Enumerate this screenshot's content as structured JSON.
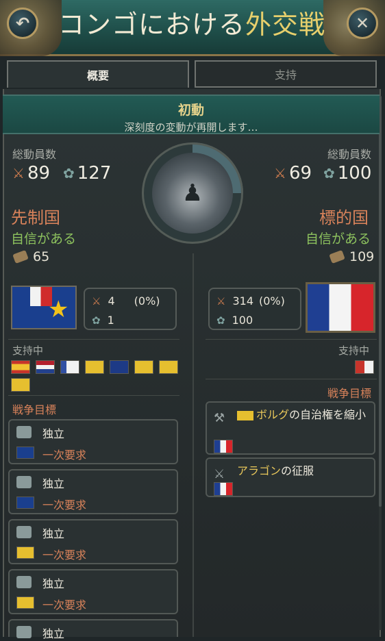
{
  "header": {
    "title_part1": "コンゴにおける",
    "title_part2": "外交戦",
    "back_icon": "↶",
    "close_icon": "✕"
  },
  "tabs": [
    {
      "label": "概要",
      "active": true
    },
    {
      "label": "支持",
      "active": false
    }
  ],
  "phase": {
    "title": "初動",
    "subtitle": "深刻度の変動が再開します…"
  },
  "left": {
    "mobilization_label": "総動員数",
    "swords": "89",
    "badge": "127",
    "role": "先制国",
    "confidence": "自信がある",
    "resource": "65",
    "mini_swords": "4",
    "mini_swords_pct": "(0%)",
    "mini_badge": "1",
    "support_label": "支持中",
    "goals_label": "戦争目標",
    "goals": [
      {
        "title": "独立",
        "requirement": "一次要求",
        "flag": "congo"
      },
      {
        "title": "独立",
        "requirement": "一次要求",
        "flag": "congo"
      },
      {
        "title": "独立",
        "requirement": "一次要求",
        "flag": "yellow"
      },
      {
        "title": "独立",
        "requirement": "一次要求",
        "flag": "yellow"
      },
      {
        "title": "独立",
        "requirement": "",
        "flag": ""
      }
    ]
  },
  "right": {
    "mobilization_label": "総動員数",
    "swords": "69",
    "badge": "100",
    "role": "標的国",
    "confidence": "自信がある",
    "resource": "109",
    "mini_swords": "314",
    "mini_swords_pct": "(0%)",
    "mini_badge": "100",
    "support_label": "支持中",
    "goals_label": "戦争目標",
    "goal1_highlight": "ボルグ",
    "goal1_rest": "の自治権を縮小",
    "goal2_highlight": "アラゴン",
    "goal2_rest": "の征服"
  },
  "icons": {
    "swords": "⚔",
    "badge": "✿",
    "chess": "♟"
  }
}
